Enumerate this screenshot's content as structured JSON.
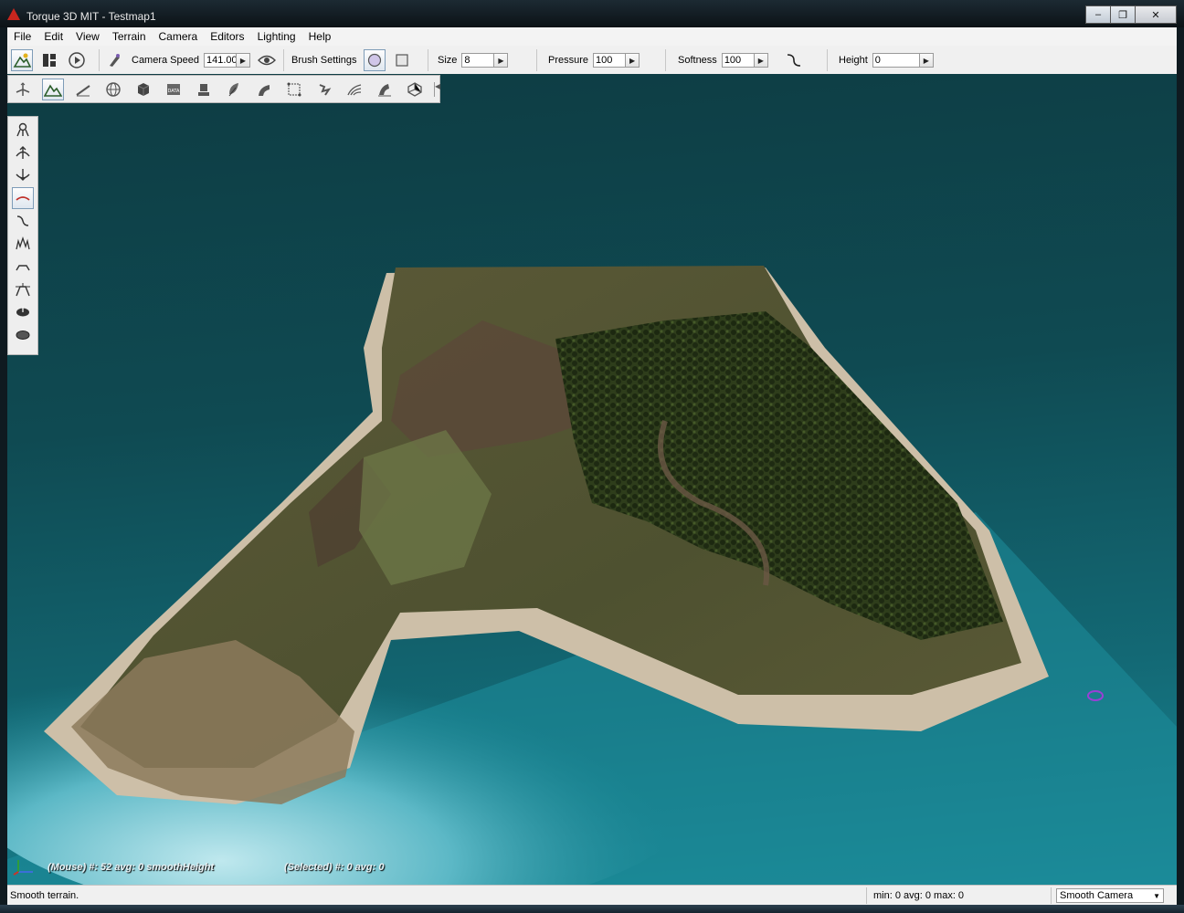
{
  "window": {
    "title": "Torque 3D MIT - Testmap1",
    "minimize": "–",
    "maximize": "❐",
    "close": "✕"
  },
  "menu": [
    "File",
    "Edit",
    "View",
    "Terrain",
    "Camera",
    "Editors",
    "Lighting",
    "Help"
  ],
  "toolbar": {
    "camera_speed_label": "Camera Speed",
    "camera_speed_value": "141.00",
    "brush_settings_label": "Brush Settings",
    "size_label": "Size",
    "size_value": "8",
    "pressure_label": "Pressure",
    "pressure_value": "100",
    "softness_label": "Softness",
    "softness_value": "100",
    "height_label": "Height",
    "height_value": "0"
  },
  "icons": {
    "editor_palette": [
      "object-editor-icon",
      "terrain-editor-icon",
      "terrain-painter-icon",
      "sky-sphere-icon",
      "material-box-icon",
      "datablock-icon",
      "decal-editor-icon",
      "forest-editor-icon",
      "road-editor-icon",
      "mesh-road-icon",
      "river-editor-icon",
      "navmesh-icon",
      "particle-editor-icon",
      "shape-editor-icon"
    ],
    "terrain_palette": [
      "grab-terrain-icon",
      "raise-height-icon",
      "lower-height-icon",
      "smooth-icon",
      "smooth-slope-icon",
      "paint-noise-icon",
      "flatten-icon",
      "set-height-icon",
      "clear-terrain-icon",
      "restore-terrain-icon"
    ]
  },
  "overlay": {
    "mouse_stats": "(Mouse) #: 52  avg: 0 smoothHeight",
    "selected_stats": "(Selected) #: 0  avg: 0"
  },
  "status": {
    "message": "Smooth terrain.",
    "stats": "min: 0  avg: 0  max: 0",
    "camera_mode": "Smooth Camera"
  },
  "colors": {
    "accent": "#7e9cb8",
    "water": "#136975",
    "grass": "#5a5a32",
    "sand": "#c2b29a",
    "trees": "#2c3a1a"
  }
}
